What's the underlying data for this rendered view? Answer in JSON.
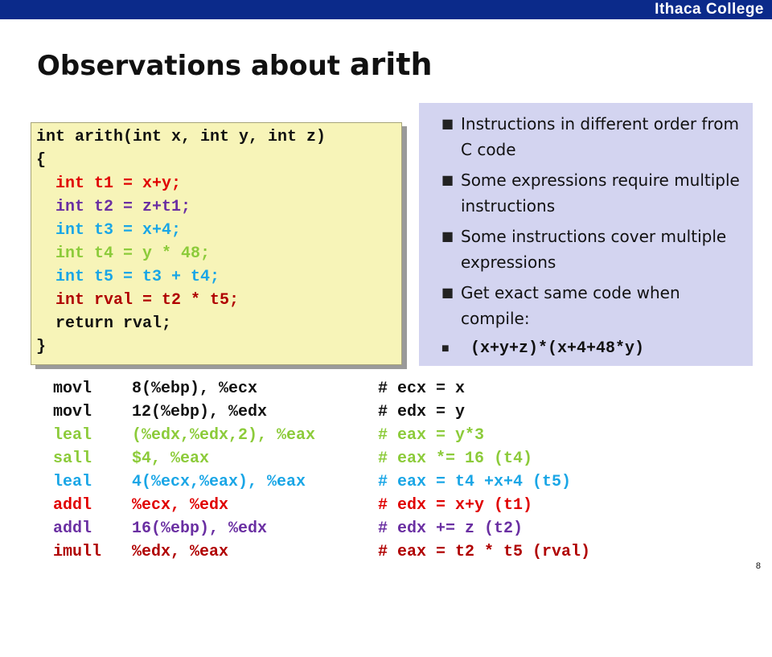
{
  "header": {
    "brand": "Ithaca College"
  },
  "slide": {
    "title_text": "Observations about ",
    "title_code": "arith",
    "page_number": "8"
  },
  "colors": {
    "black": "#111111",
    "red": "#e00000",
    "purple": "#6a2fa2",
    "blue": "#1aa6e6",
    "green": "#8ccb3a",
    "dark_red": "#b00000",
    "code_bg": "#f7f4b8",
    "notes_bg": "#d3d4f0",
    "bar_blue": "#0b2a8a"
  },
  "c_code": {
    "lines": [
      {
        "text": "int arith(int x, int y, int z)",
        "color": "#111111"
      },
      {
        "text": "{",
        "color": "#111111"
      },
      {
        "text": "  int t1 = x+y;",
        "color": "#e00000"
      },
      {
        "text": "  int t2 = z+t1;",
        "color": "#6a2fa2"
      },
      {
        "text": "  int t3 = x+4;",
        "color": "#1aa6e6"
      },
      {
        "text": "  int t4 = y * 48;",
        "color": "#8ccb3a"
      },
      {
        "text": "  int t5 = t3 + t4;",
        "color": "#1aa6e6"
      },
      {
        "text": "  int rval = t2 * t5;",
        "color": "#b00000"
      },
      {
        "text": "  return rval;",
        "color": "#111111"
      },
      {
        "text": "}",
        "color": "#111111"
      }
    ]
  },
  "notes": {
    "bullet_glyph": "■",
    "items": [
      {
        "text": "Instructions in different order from C code",
        "code": false
      },
      {
        "text": "Some expressions require multiple instructions",
        "code": false
      },
      {
        "text": "Some instructions cover multiple expressions",
        "code": false
      },
      {
        "text": "Get exact same code when compile:",
        "code": false
      },
      {
        "text": " (x+y+z)*(x+4+48*y)",
        "code": true
      }
    ]
  },
  "assembly": {
    "rows": [
      {
        "op": "movl",
        "args": "8(%ebp), %ecx",
        "comment": "# ecx = x",
        "color": "#111111"
      },
      {
        "op": "movl",
        "args": "12(%ebp), %edx",
        "comment": "# edx = y",
        "color": "#111111"
      },
      {
        "op": "leal",
        "args": "(%edx,%edx,2), %eax",
        "comment": "# eax = y*3",
        "color": "#8ccb3a"
      },
      {
        "op": "sall",
        "args": "$4, %eax",
        "comment": "# eax *= 16 (t4)",
        "color": "#8ccb3a"
      },
      {
        "op": "leal",
        "args": "4(%ecx,%eax), %eax",
        "comment": "# eax = t4 +x+4 (t5)",
        "color": "#1aa6e6"
      },
      {
        "op": "addl",
        "args": "%ecx, %edx",
        "comment": "# edx = x+y (t1)",
        "color": "#e00000"
      },
      {
        "op": "addl",
        "args": "16(%ebp), %edx",
        "comment": "# edx += z (t2)",
        "color": "#6a2fa2"
      },
      {
        "op": "imull",
        "args": "%edx, %eax",
        "comment": "# eax = t2 * t5 (rval)",
        "color": "#b00000"
      }
    ]
  }
}
